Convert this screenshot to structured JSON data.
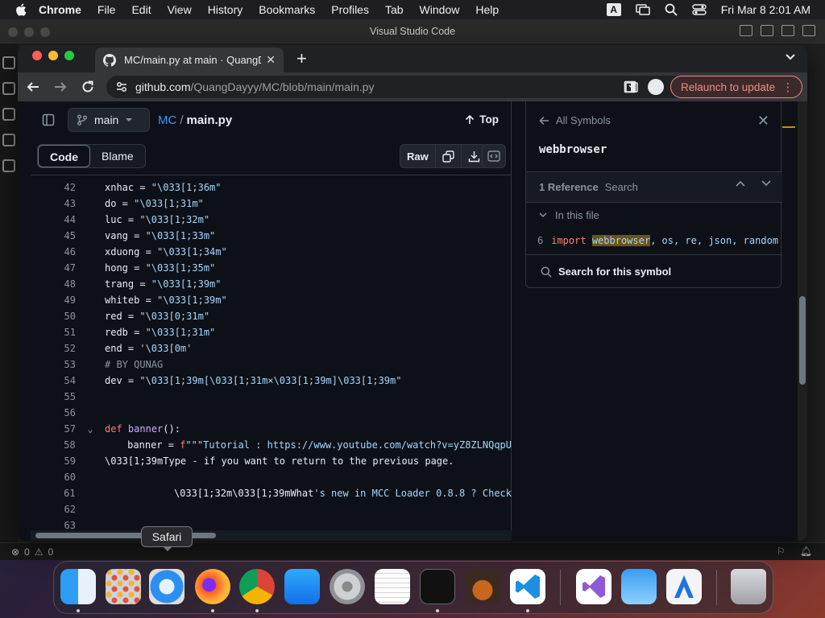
{
  "menubar": {
    "app_name": "Chrome",
    "items": [
      "File",
      "Edit",
      "View",
      "History",
      "Bookmarks",
      "Profiles",
      "Tab",
      "Window",
      "Help"
    ],
    "input_source": "A",
    "datetime": "Fri Mar 8  2:01 AM"
  },
  "vscode": {
    "title": "Visual Studio Code",
    "status_errors": "0",
    "status_warnings": "0"
  },
  "chrome": {
    "tab_title": "MC/main.py at main · QuangDa",
    "url_host": "github.com",
    "url_path": "/QuangDayyy/MC/blob/main/main.py",
    "relaunch_label": "Relaunch to update"
  },
  "github": {
    "branch": "main",
    "repo": "MC",
    "separator": "/",
    "file": "main.py",
    "top_label": "Top",
    "code_tab": "Code",
    "blame_tab": "Blame",
    "raw_label": "Raw",
    "code_lines": [
      {
        "n": "42",
        "fold": "",
        "t": "xnhac = \"\\033[1;36m\""
      },
      {
        "n": "43",
        "fold": "",
        "t": "do = \"\\033[1;31m\""
      },
      {
        "n": "44",
        "fold": "",
        "t": "luc = \"\\033[1;32m\""
      },
      {
        "n": "45",
        "fold": "",
        "t": "vang = \"\\033[1;33m\""
      },
      {
        "n": "46",
        "fold": "",
        "t": "xduong = \"\\033[1;34m\""
      },
      {
        "n": "47",
        "fold": "",
        "t": "hong = \"\\033[1;35m\""
      },
      {
        "n": "48",
        "fold": "",
        "t": "trang = \"\\033[1;39m\""
      },
      {
        "n": "49",
        "fold": "",
        "t": "whiteb = \"\\033[1;39m\""
      },
      {
        "n": "50",
        "fold": "",
        "t": "red = \"\\033[0;31m\""
      },
      {
        "n": "51",
        "fold": "",
        "t": "redb = \"\\033[1;31m\""
      },
      {
        "n": "52",
        "fold": "",
        "t": "end = '\\033[0m'"
      },
      {
        "n": "53",
        "fold": "",
        "t": "# BY QUNAG"
      },
      {
        "n": "54",
        "fold": "",
        "t": "dev = \"\\033[1;39m[\\033[1;31m×\\033[1;39m]\\033[1;39m\""
      },
      {
        "n": "55",
        "fold": "",
        "t": ""
      },
      {
        "n": "56",
        "fold": "",
        "t": ""
      },
      {
        "n": "57",
        "fold": "⌄",
        "t": "def banner():"
      },
      {
        "n": "58",
        "fold": "",
        "t": "    banner = f\"\"\"Tutorial : https://www.youtube.com/watch?v=yZ8ZLNQqpU"
      },
      {
        "n": "59",
        "fold": "",
        "t": "\\033[1;39mType - if you want to return to the previous page."
      },
      {
        "n": "60",
        "fold": "",
        "t": ""
      },
      {
        "n": "61",
        "fold": "",
        "t": "            \\033[1;32m\\033[1;39mWhat's new in MCC Loader 0.8.8 ? Check"
      },
      {
        "n": "62",
        "fold": "",
        "t": ""
      },
      {
        "n": "63",
        "fold": "",
        "t": ""
      }
    ]
  },
  "symbols": {
    "back_label": "All Symbols",
    "symbol_name": "webbrowser",
    "ref_count": "1 Reference",
    "search_placeholder": "Search",
    "in_this_file": "In this file",
    "ref_line_number": "6",
    "ref_keyword": "import",
    "ref_highlight": "webbrowser",
    "ref_rest": ", os, re, json, random",
    "search_symbol_label": "Search for this symbol"
  },
  "dock": {
    "tooltip": "Safari",
    "apps": [
      "finder-icon",
      "launchpad-icon",
      "safari-icon",
      "firefox-icon",
      "chrome-icon",
      "app-store-icon",
      "system-settings-icon",
      "textedit-icon",
      "terminal-icon",
      "instruments-icon",
      "vscode-icon",
      "visual-studio-icon",
      "weather-icon",
      "xcode-instruments-icon",
      "trash-icon"
    ]
  },
  "colors": {
    "link": "#4493f8",
    "relaunch": "#f28b82",
    "keyword": "#ff7b72",
    "function": "#d2a8ff",
    "string": "#a5d6ff"
  }
}
